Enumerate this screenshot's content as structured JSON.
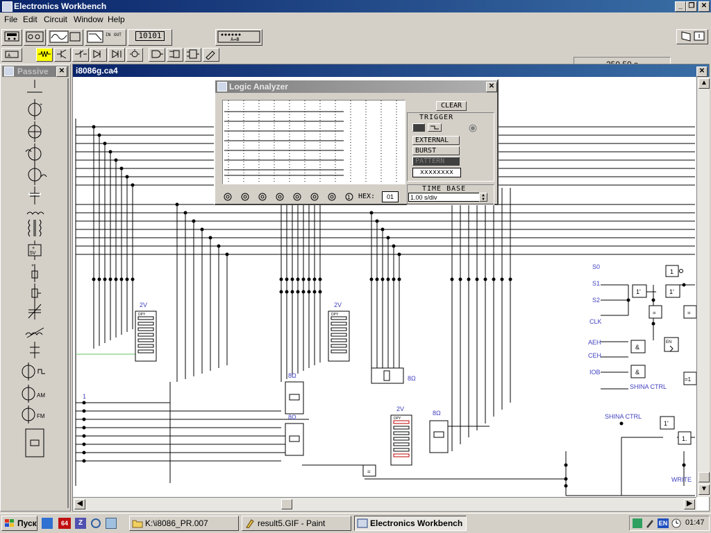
{
  "app": {
    "title": "Electronics Workbench"
  },
  "menu": [
    "File",
    "Edit",
    "Circuit",
    "Window",
    "Help"
  ],
  "toolbar": {
    "counter_label": "10101",
    "timer": "250.50 s",
    "io_in": "IN",
    "io_out": "OUT",
    "converter_label": "A↔B"
  },
  "parts_bin": {
    "title": "Passive",
    "bat_label": "5V"
  },
  "circuit": {
    "title": "i8086g.ca4",
    "labels": {
      "s0": "S0",
      "s1": "S1",
      "s2": "S2",
      "clk": "CLK",
      "aeh": "AEH",
      "ceh": "CEH",
      "iob": "IOB",
      "shina1": "SHINA CTRL",
      "shina2": "SHINA CTRL",
      "write": "WRITE",
      "v2_1": "2V",
      "v2_2": "2V",
      "v2_3": "2V",
      "r8_1": "8Ω",
      "r8_2": "8Ω",
      "r8_3": "8Ω",
      "r8_4": "8Ω",
      "one": "1",
      "gate1": "1",
      "gate1p": "1'",
      "gate1p2": "1'",
      "gate1p3": "1'",
      "gate1dot": "1.",
      "eq": "=",
      "eq2": "=",
      "amp": "&",
      "amp2": "&",
      "eq1": "=1",
      "en": "EN",
      "dpy": "DPY"
    }
  },
  "logic_analyzer": {
    "title": "Logic Analyzer",
    "clear": "CLEAR",
    "trigger": "TRIGGER",
    "external": "EXTERNAL",
    "burst": "BURST",
    "pattern": "PATTERN",
    "pattern_value": "xxxxxxxx",
    "time_base": "TIME BASE",
    "time_base_value": "1.00 s/div",
    "hex_label": "HEX:",
    "hex_value": "01",
    "probe_last": "1"
  },
  "taskbar": {
    "start": "Пуск",
    "tasks": [
      {
        "label": "K:\\i8086_PR.007"
      },
      {
        "label": "result5.GIF - Paint"
      },
      {
        "label": "Electronics Workbench"
      }
    ],
    "lang": "EN",
    "clock": "01:47",
    "ql_64": "64",
    "ql_z": "Z"
  }
}
